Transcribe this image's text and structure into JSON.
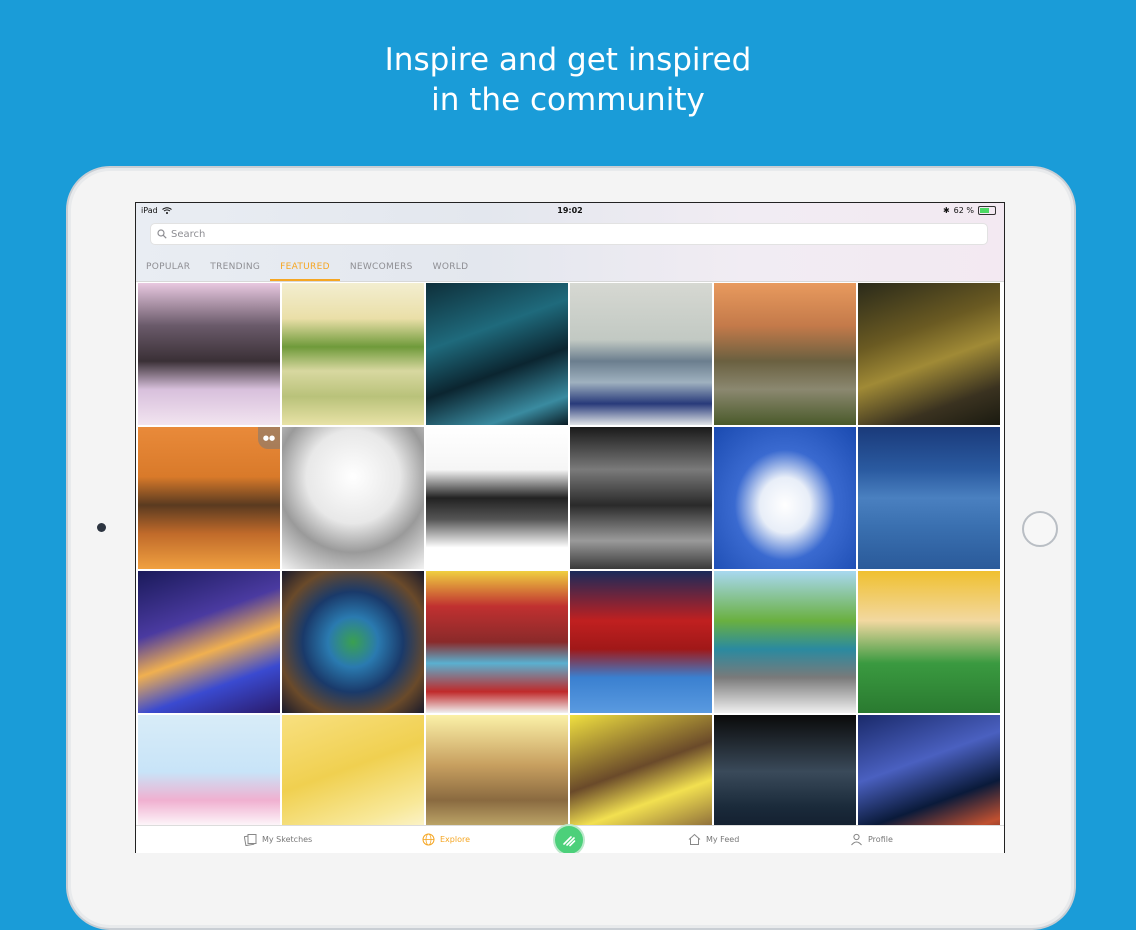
{
  "headline": {
    "line1": "Inspire and get inspired",
    "line2": "in the community"
  },
  "status_bar": {
    "device": "iPad",
    "time": "19:02",
    "battery": "62 %",
    "battery_level": 0.62
  },
  "search": {
    "placeholder": "Search"
  },
  "tabs": [
    {
      "label": "POPULAR",
      "active": false
    },
    {
      "label": "TRENDING",
      "active": false
    },
    {
      "label": "FEATURED",
      "active": true
    },
    {
      "label": "NEWCOMERS",
      "active": false
    },
    {
      "label": "WORLD",
      "active": false
    }
  ],
  "colors": {
    "background": "#1a9cd8",
    "accent": "#f5a623",
    "fab": "#4cd07a"
  },
  "sketches": [
    {
      "name": "castle-sketch",
      "bg": "linear-gradient(180deg,#e8c8e0 0%,#6a5a6a 30%,#3a3036 55%,#d8c0dc 75%,#f2e4f0 100%)"
    },
    {
      "name": "lake-landscape-sketch",
      "bg": "linear-gradient(180deg,#f3eed0 0%,#eadfa8 25%,#6f9a3a 45%,#d8d8a0 62%,#b9c27a 80%,#e8e2a6 100%)"
    },
    {
      "name": "night-bridge-sketch",
      "bg": "linear-gradient(160deg,#0e2f3a 0%,#1f6a7c 35%,#0b2530 60%,#3a8ba0 85%,#0a1c24 100%)"
    },
    {
      "name": "city-tower-sketch",
      "bg": "linear-gradient(180deg,#d6d8d2 0%,#c2c9c3 40%,#6b7e8e 55%,#9fb1bf 70%,#283a7a 85%,#dfe3e6 100%)"
    },
    {
      "name": "street-sunset-sketch",
      "bg": "linear-gradient(180deg,#e89a5e 0%,#c47a4a 30%,#6a6040 55%,#8b8870 75%,#4a5a2a 100%)"
    },
    {
      "name": "night-lamps-sketch",
      "bg": "linear-gradient(160deg,#2a2a1a 0%,#6a5a22 35%,#a08a36 55%,#3a3220 80%,#1a1a10 100%)"
    },
    {
      "name": "orange-building-sketch",
      "bg": "linear-gradient(180deg,#e98a3a 0%,#d97a2a 35%,#5a3a20 55%,#c06a2a 75%,#f0a040 100%)",
      "group": true
    },
    {
      "name": "pencil-village-sketch",
      "bg": "radial-gradient(circle at 50% 35%,#ffffff 0%,#e8e8e8 40%,#9a9a9a 65%,#f2f2f2 100%)"
    },
    {
      "name": "ink-domes-sketch",
      "bg": "linear-gradient(180deg,#ffffff 0%,#f6f6f6 30%,#222222 50%,#555555 65%,#ffffff 85%,#ffffff 100%)"
    },
    {
      "name": "umbrella-couple-sketch",
      "bg": "linear-gradient(180deg,#1a1a1a 0%,#7a7a7a 30%,#2a2a2a 55%,#9a9a9a 80%,#3a3a3a 100%)"
    },
    {
      "name": "burj-al-arab-sketch",
      "bg": "radial-gradient(ellipse at 50% 55%,#ffffff 0%,#e8eef8 25%,#3a6ad0 50%,#1a4ab0 100%)"
    },
    {
      "name": "harbor-night-sketch",
      "bg": "linear-gradient(180deg,#1a3a7a 0%,#2a5aa0 30%,#4a80c0 50%,#3a70b0 70%,#2a5a9a 100%)"
    },
    {
      "name": "anime-girl-city-sketch",
      "bg": "linear-gradient(160deg,#1a1a5a 0%,#4a3aa0 35%,#f0b050 55%,#3a4ad0 75%,#2a1a6a 100%)"
    },
    {
      "name": "earth-tunnel-sketch",
      "bg": "radial-gradient(circle at 50% 50%,#3aa050 0%,#2a7ab0 25%,#1a3a6a 50%,#6a4a2a 75%,#1a1a2a 100%)"
    },
    {
      "name": "pikachu-3ds-sketch",
      "bg": "linear-gradient(180deg,#f0d040 0%,#c03030 25%,#8a2a2a 50%,#5ab0d0 65%,#c02a2a 85%,#f0f0f0 100%)"
    },
    {
      "name": "angry-birds-sketch",
      "bg": "linear-gradient(180deg,#1a2a5a 0%,#c02020 35%,#a01818 55%,#3a80d0 75%,#5a9ae0 100%)"
    },
    {
      "name": "minecraft-sketch",
      "bg": "linear-gradient(180deg,#a8d8f0 0%,#6ab040 35%,#2a8aa0 55%,#7a7a7a 75%,#f0f0f0 100%)"
    },
    {
      "name": "elf-boy-sketch",
      "bg": "linear-gradient(180deg,#f0c030 0%,#f2d8a0 35%,#3a9a40 65%,#2a7a30 100%)"
    },
    {
      "name": "princess-trophy-sketch",
      "bg": "linear-gradient(180deg,#d8ecf8 0%,#c8e4f8 40%,#f0b0d0 60%,#ffffff 80%,#f8d040 100%)"
    },
    {
      "name": "chocobo-sketch",
      "bg": "linear-gradient(160deg,#f8e080 0%,#f0d050 40%,#f8e898 70%,#ffffff 100%)"
    },
    {
      "name": "fashion-figure-sketch",
      "bg": "linear-gradient(180deg,#fbf1a8 0%,#c8a060 35%,#8a6a40 60%,#f8ec98 100%)"
    },
    {
      "name": "flower-girl-sketch",
      "bg": "linear-gradient(160deg,#f0e040 0%,#6a4a2a 40%,#f2e050 60%,#8a6a3a 85%,#f8e860 100%)"
    },
    {
      "name": "dark-knight-sketch",
      "bg": "linear-gradient(180deg,#0a0a0a 0%,#3a4a5a 40%,#1a2a3a 65%,#0a1020 100%)"
    },
    {
      "name": "blue-warrior-sketch",
      "bg": "linear-gradient(160deg,#1a2a6a 0%,#4a60c0 35%,#0a1a3a 60%,#c05030 80%,#1a1020 100%)"
    }
  ],
  "tab_bar": {
    "my_sketches": "My Sketches",
    "explore": "Explore",
    "my_feed": "My Feed",
    "profile": "Profile"
  }
}
